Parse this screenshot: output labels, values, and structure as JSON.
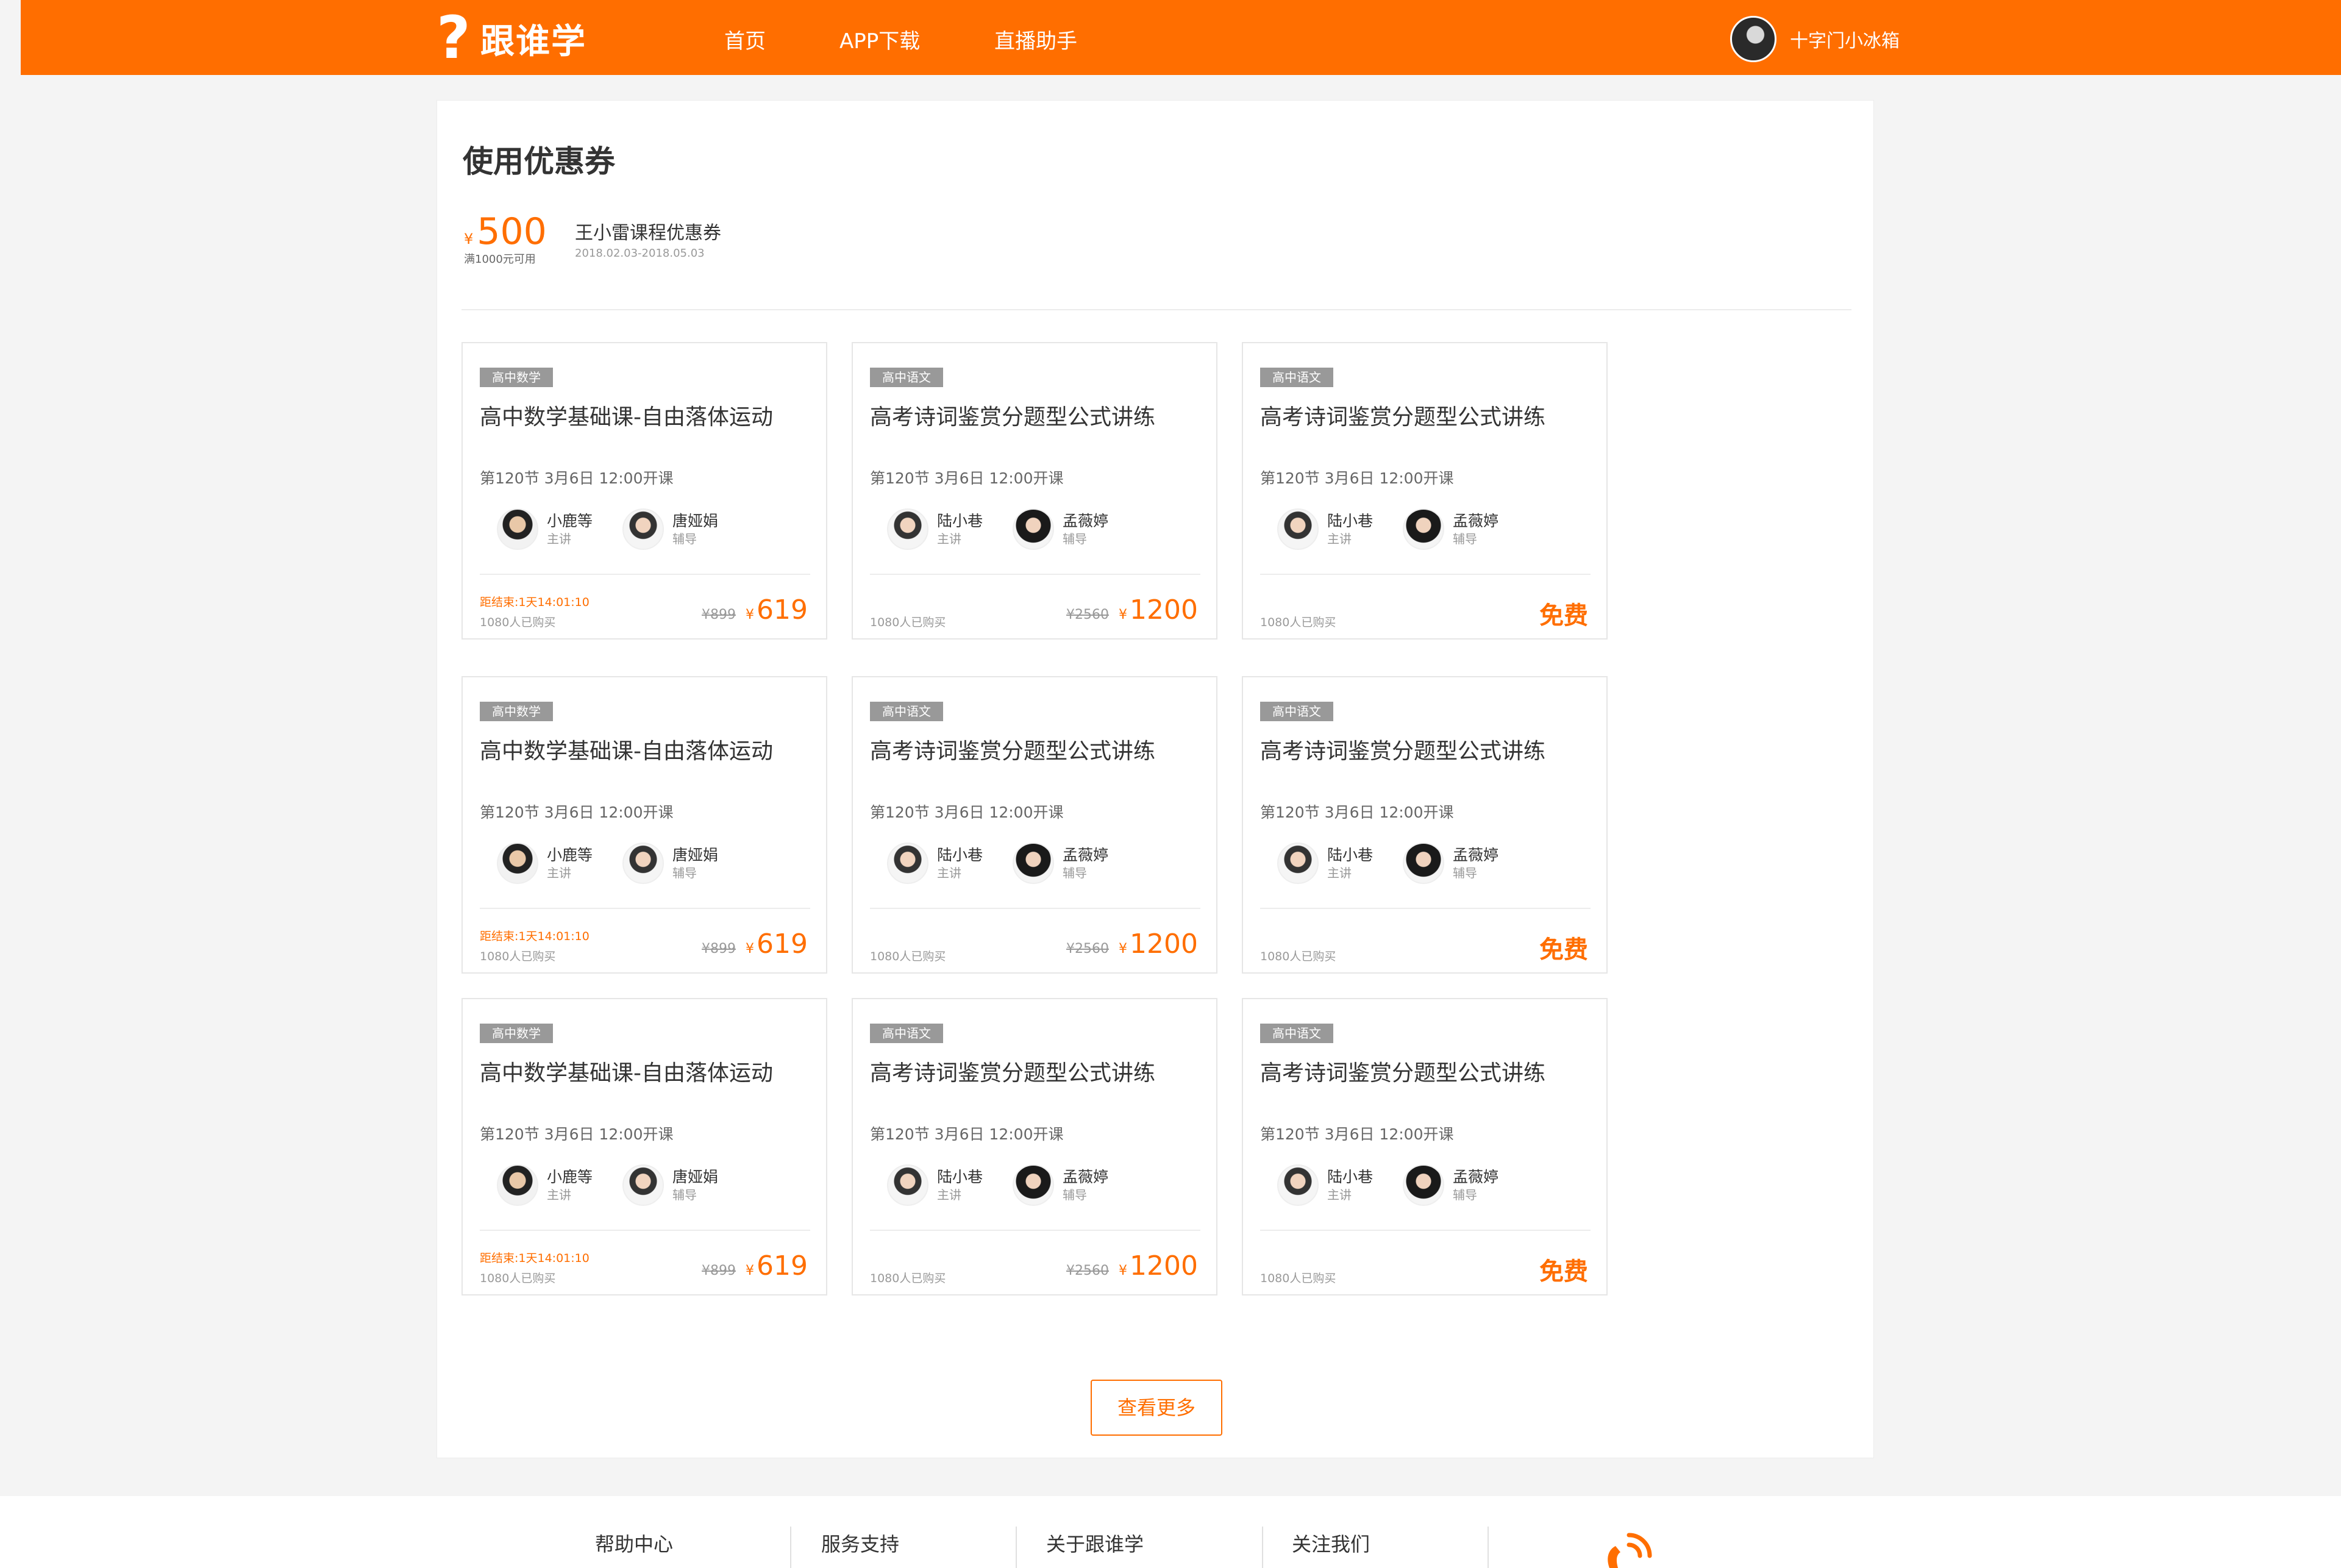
{
  "header": {
    "logo_text": "跟谁学",
    "nav": [
      "首页",
      "APP下载",
      "直播助手"
    ],
    "user_name": "十字门小冰箱",
    "brand_color": "#ff6e00"
  },
  "page": {
    "title": "使用优惠券"
  },
  "coupon": {
    "currency": "¥",
    "amount": "500",
    "condition": "满1000元可用",
    "name": "王小雷课程优惠券",
    "date_range": "2018.02.03-2018.05.03"
  },
  "courses": [
    {
      "tag": "高中数学",
      "title": "高中数学基础课-自由落体运动",
      "schedule": "第120节 3月6日 12:00开课",
      "teachers": [
        {
          "name": "小鹿等",
          "role": "主讲"
        },
        {
          "name": "唐娅娟",
          "role": "辅导"
        }
      ],
      "countdown": "距结束:1天14:01:10",
      "bought": "1080人已购买",
      "old_price": "¥899",
      "currency": "¥",
      "price": "619",
      "free_label": ""
    },
    {
      "tag": "高中语文",
      "title": "高考诗词鉴赏分题型公式讲练",
      "schedule": "第120节 3月6日 12:00开课",
      "teachers": [
        {
          "name": "陆小巷",
          "role": "主讲"
        },
        {
          "name": "孟薇婷",
          "role": "辅导"
        }
      ],
      "countdown": "",
      "bought": "1080人已购买",
      "old_price": "¥2560",
      "currency": "¥",
      "price": "1200",
      "free_label": ""
    },
    {
      "tag": "高中语文",
      "title": "高考诗词鉴赏分题型公式讲练",
      "schedule": "第120节 3月6日 12:00开课",
      "teachers": [
        {
          "name": "陆小巷",
          "role": "主讲"
        },
        {
          "name": "孟薇婷",
          "role": "辅导"
        }
      ],
      "countdown": "",
      "bought": "1080人已购买",
      "old_price": "",
      "currency": "",
      "price": "",
      "free_label": "免费"
    }
  ],
  "more_button": "查看更多",
  "footer": {
    "links": [
      "帮助中心",
      "服务支持",
      "关于跟谁学",
      "关注我们"
    ]
  }
}
